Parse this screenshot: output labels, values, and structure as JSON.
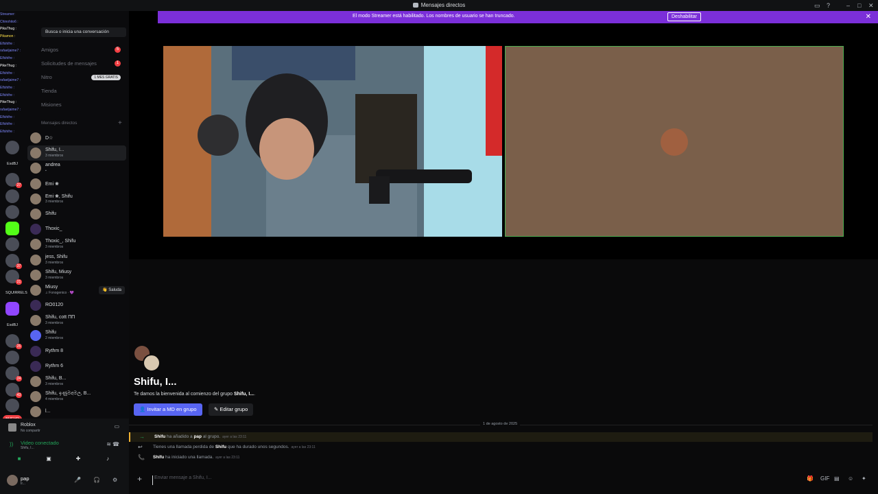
{
  "window": {
    "title": "Mensajes directos",
    "controls": [
      "–",
      "□",
      "✕"
    ]
  },
  "banner": {
    "message": "El modo Streamer está habilitado. Los nombres de usuario se han truncado.",
    "button": "Deshabilitar",
    "close": "✕"
  },
  "overlay_chat": [
    {
      "text": "Streamer:",
      "c": "b"
    },
    {
      "text": "Chinohito6 :",
      "c": "b"
    },
    {
      "text": "PikaThug :",
      "c": "w"
    },
    {
      "text": "Pikamon :",
      "c": "y"
    },
    {
      "text": "Elfshifre :",
      "c": "b"
    },
    {
      "text": "rafaeljaime7 :",
      "c": "b"
    },
    {
      "text": "Elfshifre :",
      "c": "b"
    },
    {
      "text": "PikeThug :",
      "c": "w"
    },
    {
      "text": "Elfshifre :",
      "c": "b"
    },
    {
      "text": "rafaeljaime7 :",
      "c": "b"
    },
    {
      "text": "Elfshifre :",
      "c": "b"
    },
    {
      "text": "Elfshifre :",
      "c": "b"
    },
    {
      "text": "PikeThug :",
      "c": "w"
    },
    {
      "text": "rafaeljaime7 :",
      "c": "b"
    },
    {
      "text": "Elfshifre :",
      "c": "b"
    },
    {
      "text": "Elfshifre :",
      "c": "b"
    },
    {
      "text": "Elfshifre :",
      "c": "b"
    }
  ],
  "sidebar": {
    "search_placeholder": "Busca o inicia una conversación",
    "nav": [
      {
        "label": "Amigos",
        "badge": "5"
      },
      {
        "label": "Solicitudes de mensajes",
        "badge": "1"
      },
      {
        "label": "Nitro",
        "pill": "1 MES GRATIS"
      },
      {
        "label": "Tienda"
      },
      {
        "label": "Misiones"
      }
    ],
    "dm_header": "Mensajes directos",
    "dm_plus": "+",
    "dms": [
      {
        "name": "D☆",
        "sub": "",
        "sel": false,
        "av": ""
      },
      {
        "name": "Shifu, I...",
        "sub": "3 miembros",
        "sel": true,
        "av": ""
      },
      {
        "name": "andrea",
        "sub": "▪",
        "sel": false,
        "av": ""
      },
      {
        "name": "Emi ❀",
        "sub": "",
        "sel": false,
        "av": ""
      },
      {
        "name": "Emi ❀, Shifu",
        "sub": "3 miembros",
        "sel": false,
        "av": ""
      },
      {
        "name": "Shifu",
        "sub": "",
        "sel": false,
        "av": ""
      },
      {
        "name": "Thoxic_",
        "sub": "",
        "sel": false,
        "av": "dark"
      },
      {
        "name": "Thoxic_, Shifu",
        "sub": "3 miembros",
        "sel": false,
        "av": ""
      },
      {
        "name": "jess, Shifu",
        "sub": "3 miembros",
        "sel": false,
        "av": ""
      },
      {
        "name": "Shifu, Miusy",
        "sub": "3 miembros",
        "sel": false,
        "av": ""
      },
      {
        "name": "Miusy",
        "sub": "♫ Fonogenico · 💜",
        "sel": false,
        "av": "",
        "action": "👋 Saluda"
      },
      {
        "name": "RO0120",
        "sub": "",
        "sel": false,
        "av": "dark"
      },
      {
        "name": "Shifu, cott ΠΠ",
        "sub": "3 miembros",
        "sel": false,
        "av": ""
      },
      {
        "name": "Shifu",
        "sub": "2 miembros",
        "sel": false,
        "av": "purple"
      },
      {
        "name": "Rythm 8",
        "sub": "",
        "sel": false,
        "av": "dark"
      },
      {
        "name": "Rythm 6",
        "sub": "",
        "sel": false,
        "av": "dark"
      },
      {
        "name": "Shifu, B...",
        "sub": "3 miembros",
        "sel": false,
        "av": ""
      },
      {
        "name": "Shifu, ඉණුමඅමල, B...",
        "sub": "4 miembros",
        "sel": false,
        "av": ""
      },
      {
        "name": "l...",
        "sub": "",
        "sel": false,
        "av": ""
      }
    ]
  },
  "rail": [
    {
      "cnt": "",
      "t": ""
    },
    {
      "cnt": "",
      "t": "EsdBJ"
    },
    {
      "cnt": "27",
      "t": ""
    },
    {
      "cnt": "",
      "t": ""
    },
    {
      "cnt": "",
      "t": ""
    },
    {
      "cnt": "",
      "t": "kick"
    },
    {
      "cnt": "",
      "t": ""
    },
    {
      "cnt": "37",
      "t": ""
    },
    {
      "cnt": "21",
      "t": ""
    },
    {
      "cnt": "",
      "t": "SQUIRRELS"
    },
    {
      "cnt": "",
      "t": "twitch"
    },
    {
      "cnt": "",
      "t": "EsdBJ"
    },
    {
      "cnt": "25",
      "t": ""
    },
    {
      "cnt": "",
      "t": ""
    },
    {
      "cnt": "24",
      "t": ""
    },
    {
      "cnt": "43",
      "t": ""
    },
    {
      "cnt": "",
      "t": ""
    }
  ],
  "rail_new": "NUEVO",
  "panel": {
    "activity_title": "Roblox",
    "activity_sub": "No compartir",
    "voice_title": "Video conectado",
    "voice_sub": "Shifu, I...",
    "user_name": "pap",
    "user_status": "Ir...",
    "btn_camera": "■",
    "btn_screen": "▣",
    "btn_activity": "✚",
    "btn_soundboard": "♪",
    "voice_noise": "≋",
    "voice_hangup": "☎",
    "activity_icon": "▭",
    "mic": "🎤",
    "headset": "🎧",
    "settings": "⚙"
  },
  "main": {
    "group_title": "Shifu, I...",
    "welcome_prefix": "Te damos la bienvenida al comienzo del grupo",
    "welcome_group": "Shifu, I...",
    "welcome_suffix": ".",
    "invite_button": "Invitar a MD en grupo",
    "edit_button": "Editar grupo",
    "date_divider": "1 de agosto de 2025",
    "system_messages": [
      {
        "arrow": "→",
        "color": "#23a55a",
        "b1": "Shifu",
        "t1": " ha añadido a ",
        "b2": "pap",
        "t2": " al grupo.",
        "time": "ayer a las 23:11",
        "hl": true
      },
      {
        "arrow": "↩",
        "color": "#b5bac1",
        "b1": "",
        "t1": "Tienes una llamada perdida de ",
        "b2": "Shifu",
        "t2": " que ha durado unos segundos.",
        "time": "ayer a las 23:11",
        "hl": false
      },
      {
        "arrow": "📞",
        "color": "#23a55a",
        "b1": "Shifu",
        "t1": " ha iniciado una llamada.",
        "b2": "",
        "t2": "",
        "time": "ayer a las 23:11",
        "hl": false
      }
    ],
    "composer_placeholder": "Enviar mensaje a Shifu, I...",
    "composer_plus": "+",
    "tools": [
      "🎁",
      "GIF",
      "▤",
      "☺",
      "✦"
    ]
  }
}
